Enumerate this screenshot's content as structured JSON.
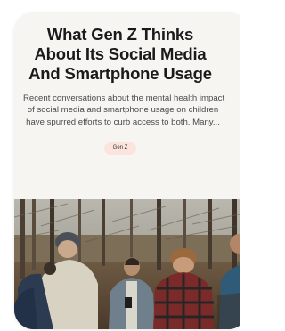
{
  "article": {
    "title_lines": [
      "What Gen Z Thinks",
      "About Its Social Media",
      "And Smartphone Usage"
    ],
    "excerpt_lines": [
      "Recent conversations about the mental health impact",
      "of social media and smartphone usage on children",
      "have spurred efforts to curb access to both. Many..."
    ],
    "tag": "Gen Z"
  },
  "colors": {
    "card_background": "#f6f5f2",
    "tag_background": "#fce4de",
    "title": "#1a1a1a",
    "excerpt": "#4a4a4a"
  }
}
